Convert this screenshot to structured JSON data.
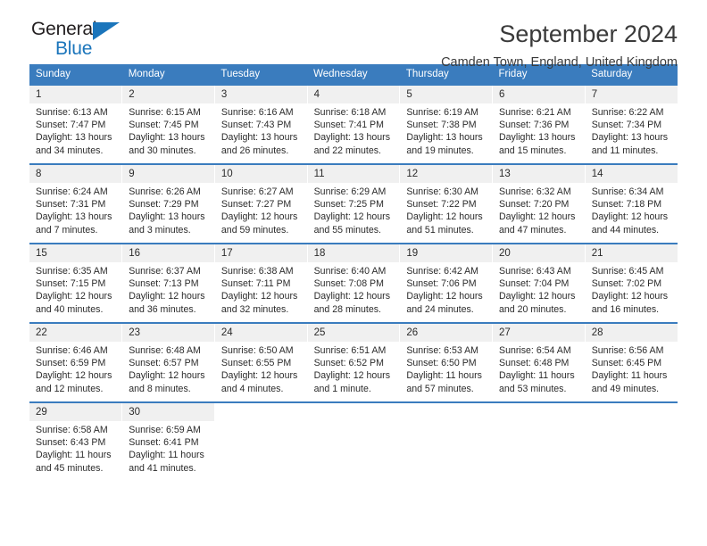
{
  "brand": {
    "name_top": "General",
    "name_bottom": "Blue",
    "triangle_icon": "brand-triangle-icon",
    "color_dark": "#231f20",
    "color_blue": "#1b75bb"
  },
  "header": {
    "title": "September 2024",
    "location": "Camden Town, England, United Kingdom"
  },
  "theme": {
    "header_blue": "#3a7cbe",
    "daynum_band": "#f0f0f0",
    "text": "#2b2b2b"
  },
  "calendar": {
    "weekdays": [
      "Sunday",
      "Monday",
      "Tuesday",
      "Wednesday",
      "Thursday",
      "Friday",
      "Saturday"
    ],
    "weeks": [
      [
        {
          "day": "1",
          "sunrise": "Sunrise: 6:13 AM",
          "sunset": "Sunset: 7:47 PM",
          "daylight": "Daylight: 13 hours and 34 minutes."
        },
        {
          "day": "2",
          "sunrise": "Sunrise: 6:15 AM",
          "sunset": "Sunset: 7:45 PM",
          "daylight": "Daylight: 13 hours and 30 minutes."
        },
        {
          "day": "3",
          "sunrise": "Sunrise: 6:16 AM",
          "sunset": "Sunset: 7:43 PM",
          "daylight": "Daylight: 13 hours and 26 minutes."
        },
        {
          "day": "4",
          "sunrise": "Sunrise: 6:18 AM",
          "sunset": "Sunset: 7:41 PM",
          "daylight": "Daylight: 13 hours and 22 minutes."
        },
        {
          "day": "5",
          "sunrise": "Sunrise: 6:19 AM",
          "sunset": "Sunset: 7:38 PM",
          "daylight": "Daylight: 13 hours and 19 minutes."
        },
        {
          "day": "6",
          "sunrise": "Sunrise: 6:21 AM",
          "sunset": "Sunset: 7:36 PM",
          "daylight": "Daylight: 13 hours and 15 minutes."
        },
        {
          "day": "7",
          "sunrise": "Sunrise: 6:22 AM",
          "sunset": "Sunset: 7:34 PM",
          "daylight": "Daylight: 13 hours and 11 minutes."
        }
      ],
      [
        {
          "day": "8",
          "sunrise": "Sunrise: 6:24 AM",
          "sunset": "Sunset: 7:31 PM",
          "daylight": "Daylight: 13 hours and 7 minutes."
        },
        {
          "day": "9",
          "sunrise": "Sunrise: 6:26 AM",
          "sunset": "Sunset: 7:29 PM",
          "daylight": "Daylight: 13 hours and 3 minutes."
        },
        {
          "day": "10",
          "sunrise": "Sunrise: 6:27 AM",
          "sunset": "Sunset: 7:27 PM",
          "daylight": "Daylight: 12 hours and 59 minutes."
        },
        {
          "day": "11",
          "sunrise": "Sunrise: 6:29 AM",
          "sunset": "Sunset: 7:25 PM",
          "daylight": "Daylight: 12 hours and 55 minutes."
        },
        {
          "day": "12",
          "sunrise": "Sunrise: 6:30 AM",
          "sunset": "Sunset: 7:22 PM",
          "daylight": "Daylight: 12 hours and 51 minutes."
        },
        {
          "day": "13",
          "sunrise": "Sunrise: 6:32 AM",
          "sunset": "Sunset: 7:20 PM",
          "daylight": "Daylight: 12 hours and 47 minutes."
        },
        {
          "day": "14",
          "sunrise": "Sunrise: 6:34 AM",
          "sunset": "Sunset: 7:18 PM",
          "daylight": "Daylight: 12 hours and 44 minutes."
        }
      ],
      [
        {
          "day": "15",
          "sunrise": "Sunrise: 6:35 AM",
          "sunset": "Sunset: 7:15 PM",
          "daylight": "Daylight: 12 hours and 40 minutes."
        },
        {
          "day": "16",
          "sunrise": "Sunrise: 6:37 AM",
          "sunset": "Sunset: 7:13 PM",
          "daylight": "Daylight: 12 hours and 36 minutes."
        },
        {
          "day": "17",
          "sunrise": "Sunrise: 6:38 AM",
          "sunset": "Sunset: 7:11 PM",
          "daylight": "Daylight: 12 hours and 32 minutes."
        },
        {
          "day": "18",
          "sunrise": "Sunrise: 6:40 AM",
          "sunset": "Sunset: 7:08 PM",
          "daylight": "Daylight: 12 hours and 28 minutes."
        },
        {
          "day": "19",
          "sunrise": "Sunrise: 6:42 AM",
          "sunset": "Sunset: 7:06 PM",
          "daylight": "Daylight: 12 hours and 24 minutes."
        },
        {
          "day": "20",
          "sunrise": "Sunrise: 6:43 AM",
          "sunset": "Sunset: 7:04 PM",
          "daylight": "Daylight: 12 hours and 20 minutes."
        },
        {
          "day": "21",
          "sunrise": "Sunrise: 6:45 AM",
          "sunset": "Sunset: 7:02 PM",
          "daylight": "Daylight: 12 hours and 16 minutes."
        }
      ],
      [
        {
          "day": "22",
          "sunrise": "Sunrise: 6:46 AM",
          "sunset": "Sunset: 6:59 PM",
          "daylight": "Daylight: 12 hours and 12 minutes."
        },
        {
          "day": "23",
          "sunrise": "Sunrise: 6:48 AM",
          "sunset": "Sunset: 6:57 PM",
          "daylight": "Daylight: 12 hours and 8 minutes."
        },
        {
          "day": "24",
          "sunrise": "Sunrise: 6:50 AM",
          "sunset": "Sunset: 6:55 PM",
          "daylight": "Daylight: 12 hours and 4 minutes."
        },
        {
          "day": "25",
          "sunrise": "Sunrise: 6:51 AM",
          "sunset": "Sunset: 6:52 PM",
          "daylight": "Daylight: 12 hours and 1 minute."
        },
        {
          "day": "26",
          "sunrise": "Sunrise: 6:53 AM",
          "sunset": "Sunset: 6:50 PM",
          "daylight": "Daylight: 11 hours and 57 minutes."
        },
        {
          "day": "27",
          "sunrise": "Sunrise: 6:54 AM",
          "sunset": "Sunset: 6:48 PM",
          "daylight": "Daylight: 11 hours and 53 minutes."
        },
        {
          "day": "28",
          "sunrise": "Sunrise: 6:56 AM",
          "sunset": "Sunset: 6:45 PM",
          "daylight": "Daylight: 11 hours and 49 minutes."
        }
      ],
      [
        {
          "day": "29",
          "sunrise": "Sunrise: 6:58 AM",
          "sunset": "Sunset: 6:43 PM",
          "daylight": "Daylight: 11 hours and 45 minutes."
        },
        {
          "day": "30",
          "sunrise": "Sunrise: 6:59 AM",
          "sunset": "Sunset: 6:41 PM",
          "daylight": "Daylight: 11 hours and 41 minutes."
        },
        {
          "day": "",
          "sunrise": "",
          "sunset": "",
          "daylight": ""
        },
        {
          "day": "",
          "sunrise": "",
          "sunset": "",
          "daylight": ""
        },
        {
          "day": "",
          "sunrise": "",
          "sunset": "",
          "daylight": ""
        },
        {
          "day": "",
          "sunrise": "",
          "sunset": "",
          "daylight": ""
        },
        {
          "day": "",
          "sunrise": "",
          "sunset": "",
          "daylight": ""
        }
      ]
    ]
  }
}
